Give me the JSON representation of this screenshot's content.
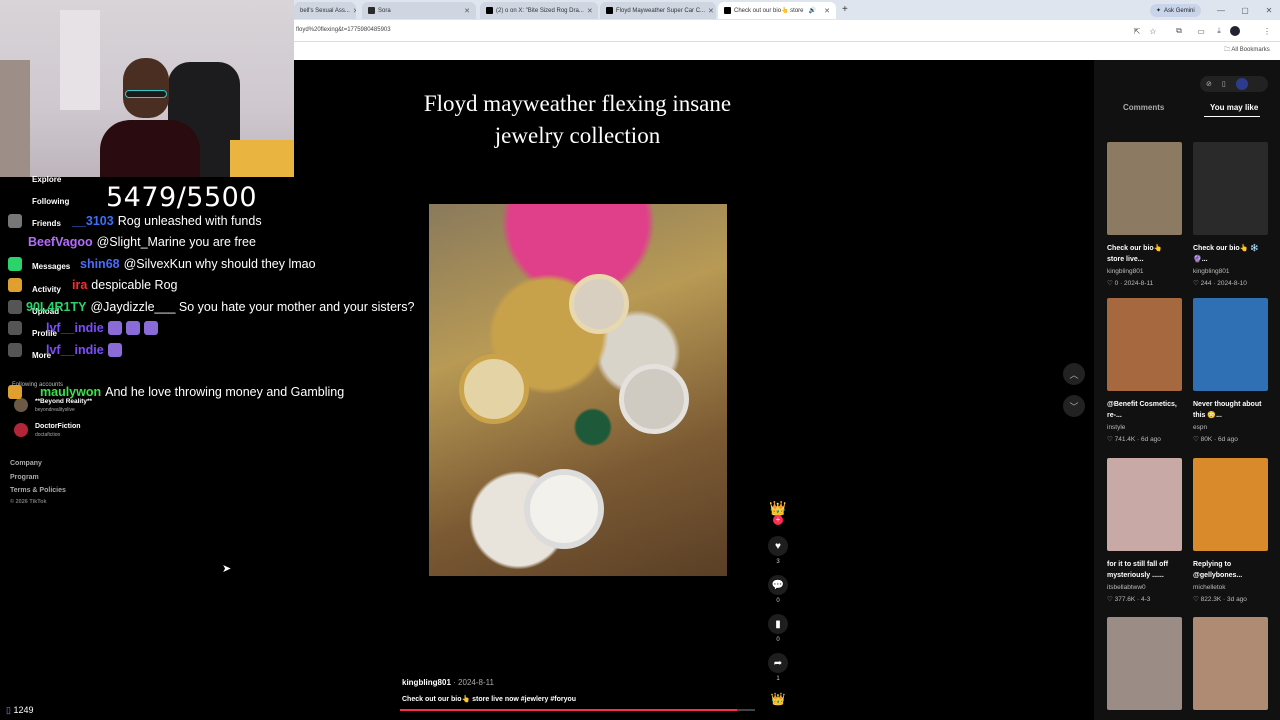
{
  "browser": {
    "tabs": [
      {
        "label": "bell's Sexual Ass...",
        "active": false
      },
      {
        "label": "Sora",
        "active": false
      },
      {
        "label": "(2) o on X: \"Bite Sized Rog Dra...",
        "active": false
      },
      {
        "label": "Floyd Mayweather Super Car C...",
        "active": false
      },
      {
        "label": "Check out our bio👆 store",
        "active": true
      }
    ],
    "url": "floyd%20flexing&t=1775980485903",
    "ask_gemini": "Ask Gemini",
    "bookmarks": "All Bookmarks"
  },
  "left_nav": [
    "Explore",
    "Following",
    "Friends",
    "Messages",
    "Activity",
    "Upload",
    "Profile",
    "More"
  ],
  "following_accounts_label": "Following accounts",
  "following_accounts": [
    {
      "name": "**Beyond Reality**",
      "handle": "beyondrealityslive"
    },
    {
      "name": "DoctorFiction",
      "handle": "doctafiction"
    }
  ],
  "footer_links": [
    "Company",
    "Program",
    "Terms & Policies",
    "© 2026 TikTok"
  ],
  "score": "5479/5500",
  "chat": [
    {
      "user": "__3103",
      "color": "#3b6fff",
      "message": "Rog unleashed with funds"
    },
    {
      "user": "BeefVagoo",
      "color": "#b56bff",
      "message": "@Slight_Marine you are free"
    },
    {
      "user": "shin68",
      "color": "#4a6cff",
      "message": "@SilvexKun why should they lmao"
    },
    {
      "user": "ira",
      "color": "#ff2c2c",
      "message": "despicable Rog"
    },
    {
      "user": "90L4R1TY",
      "color": "#2bd46a",
      "message": "@Jaydizzle___ So you hate your mother and your sisters?"
    },
    {
      "user": "lvf__indie",
      "color": "#7c4dff",
      "message": ""
    },
    {
      "user": "lvf__indie",
      "color": "#7c4dff",
      "message": ""
    },
    {
      "user": "maulywon",
      "color": "#3ae24c",
      "message": "And he love throwing money and Gambling"
    }
  ],
  "video": {
    "title": "Floyd mayweather flexing insane jewelry collection",
    "author": "kingbling801",
    "date": "2024-8-11",
    "caption": "Check out our bio👆 store live now #jewlery #foryou",
    "progress": 0.95,
    "likes": "3",
    "comments": "0",
    "saves": "0",
    "shares": "1"
  },
  "right_panel": {
    "tabs": [
      "Comments",
      "You may like"
    ],
    "cards": [
      {
        "caption": "Check our bio👆 store live...",
        "user": "kingbling801",
        "likes": "0",
        "date": "2024-8-11",
        "thumb": "#8c7a63"
      },
      {
        "caption": "Check our bio👆 ❄️🔮...",
        "user": "kingbling801",
        "likes": "244",
        "date": "2024-8-10",
        "thumb": "#2a2a2a"
      },
      {
        "caption": "@Benefit Cosmetics, re-...",
        "user": "instyle",
        "likes": "741.4K",
        "date": "6d ago",
        "thumb": "#a5683f"
      },
      {
        "caption": "Never thought about this 😳...",
        "user": "espn",
        "likes": "80K",
        "date": "6d ago",
        "thumb": "#2f6fb3"
      },
      {
        "caption": "for it to still fall off mysteriously ......",
        "user": "itsbellabtww0",
        "likes": "377.6K",
        "date": "4-3",
        "thumb": "#c9a9a6"
      },
      {
        "caption": "Replying to @gellybones...",
        "user": "michelletok",
        "likes": "822.3K",
        "date": "3d ago",
        "thumb": "#d98a2b"
      },
      {
        "caption": "",
        "user": "",
        "likes": "",
        "date": "",
        "thumb": "#9b8d86"
      },
      {
        "caption": "",
        "user": "",
        "likes": "",
        "date": "",
        "thumb": "#b08b74"
      }
    ]
  },
  "viewer_count": "1249"
}
